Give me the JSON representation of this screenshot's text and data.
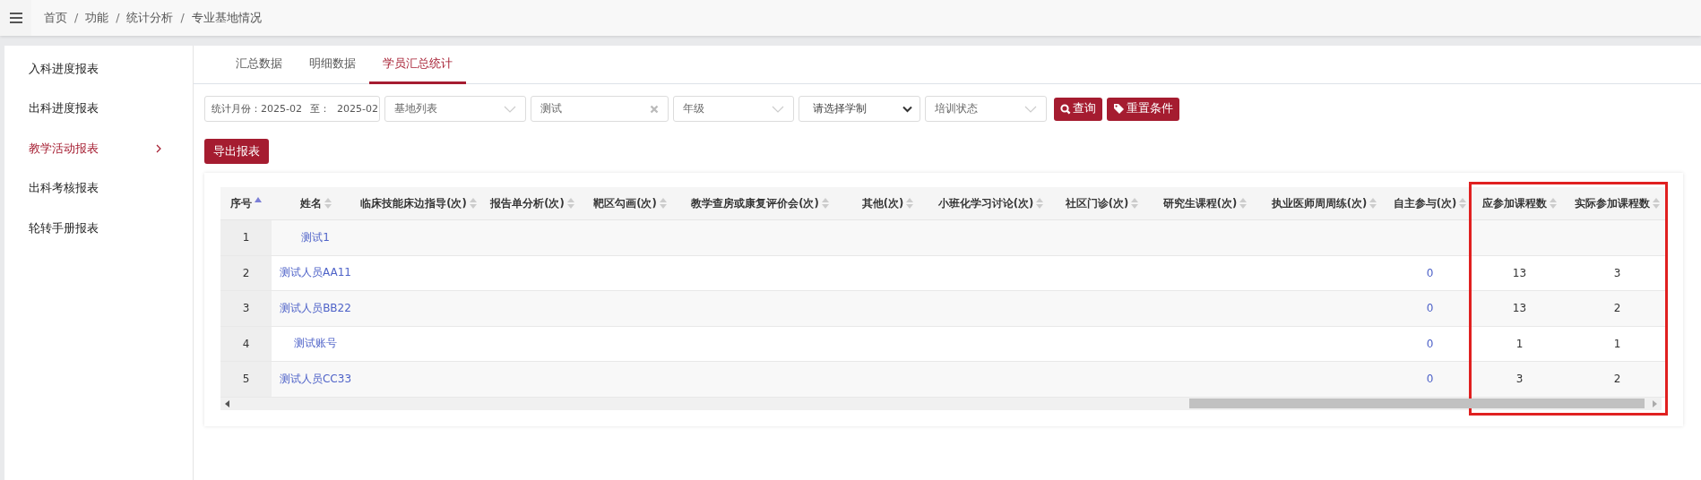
{
  "breadcrumb": [
    {
      "kind": "crumb",
      "label": "首页"
    },
    {
      "kind": "separator",
      "label": "/"
    },
    {
      "kind": "crumb",
      "label": "功能"
    },
    {
      "kind": "separator",
      "label": "/"
    },
    {
      "kind": "crumb",
      "label": "统计分析"
    },
    {
      "kind": "separator",
      "label": "/"
    },
    {
      "kind": "crumb",
      "label": "专业基地情况"
    }
  ],
  "sidebar": {
    "items": [
      {
        "label": "入科进度报表",
        "selected": false,
        "expandable": false
      },
      {
        "label": "出科进度报表",
        "selected": false,
        "expandable": false
      },
      {
        "label": "教学活动报表",
        "selected": true,
        "expandable": true
      },
      {
        "label": "出科考核报表",
        "selected": false,
        "expandable": false
      },
      {
        "label": "轮转手册报表",
        "selected": false,
        "expandable": false
      }
    ]
  },
  "tabs": [
    {
      "label": "汇总数据",
      "selected": false
    },
    {
      "label": "明细数据",
      "selected": false
    },
    {
      "label": "学员汇总统计",
      "selected": true
    }
  ],
  "filters": [
    {
      "kind": "range",
      "label": "统计月份：",
      "from": "2025-02",
      "separator": "至：",
      "to": "2025-02"
    },
    {
      "kind": "dropdown",
      "placeholder": "基地列表"
    },
    {
      "kind": "clearable",
      "value": "测试"
    },
    {
      "kind": "dropdown",
      "placeholder": "年级"
    },
    {
      "kind": "select",
      "value": "请选择学制"
    },
    {
      "kind": "dropdown",
      "placeholder": "培训状态"
    }
  ],
  "buttons": [
    {
      "label": "查询"
    },
    {
      "label": "重置条件"
    }
  ],
  "export_button": "导出报表",
  "table": {
    "columns": [
      {
        "label": "序号",
        "sorted": true,
        "highlighted": false
      },
      {
        "label": "姓名",
        "sorted": false,
        "highlighted": false
      },
      {
        "label": "临床技能床边指导(次)",
        "sorted": false,
        "highlighted": false
      },
      {
        "label": "报告单分析(次)",
        "sorted": false,
        "highlighted": false
      },
      {
        "label": "靶区勾画(次)",
        "sorted": false,
        "highlighted": false
      },
      {
        "label": "教学查房或康复评价会(次)",
        "sorted": false,
        "highlighted": false
      },
      {
        "label": "其他(次)",
        "sorted": false,
        "highlighted": false
      },
      {
        "label": "小班化学习讨论(次)",
        "sorted": false,
        "highlighted": false
      },
      {
        "label": "社区门诊(次)",
        "sorted": false,
        "highlighted": false
      },
      {
        "label": "研究生课程(次)",
        "sorted": false,
        "highlighted": false
      },
      {
        "label": "执业医师周周练(次)",
        "sorted": false,
        "highlighted": false
      },
      {
        "label": "自主参与(次)",
        "sorted": false,
        "highlighted": false
      },
      {
        "label": "应参加课程数",
        "sorted": false,
        "highlighted": true
      },
      {
        "label": "实际参加课程数",
        "sorted": false,
        "highlighted": true
      }
    ],
    "rows": [
      {
        "index": "1",
        "name": "测试1"
      },
      {
        "index": "2",
        "name": "测试人员AA11",
        "self": "0",
        "required": "13",
        "actual": "3"
      },
      {
        "index": "3",
        "name": "测试人员BB22",
        "self": "0",
        "required": "13",
        "actual": "2"
      },
      {
        "index": "4",
        "name": "测试账号",
        "self": "0",
        "required": "1",
        "actual": "1"
      },
      {
        "index": "5",
        "name": "测试人员CC33",
        "self": "0",
        "required": "3",
        "actual": "2"
      }
    ]
  }
}
